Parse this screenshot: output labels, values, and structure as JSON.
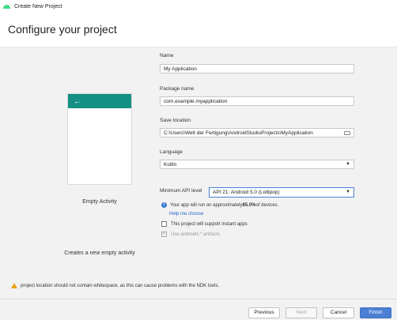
{
  "window": {
    "title": "Create New Project"
  },
  "header": {
    "title": "Configure your project"
  },
  "template": {
    "name": "Empty Activity",
    "description": "Creates a new empty activity",
    "back_arrow": "←"
  },
  "form": {
    "name": {
      "label": "Name",
      "value": "My Application"
    },
    "package": {
      "label": "Package name",
      "value": "com.example.myapplication"
    },
    "save_location": {
      "label": "Save location",
      "value": "C:\\Users\\Welt der Fertigung\\AndroidStudioProjects\\MyApplication"
    },
    "language": {
      "label": "Language",
      "value": "Kotlin"
    },
    "min_api": {
      "label": "Minimum API level",
      "value": "API 21: Android 5.0 (Lollipop)"
    },
    "info_text_before": "Your app will run on approximately ",
    "info_percent": "85.0%",
    "info_text_after": " of devices.",
    "help_link": "Help me choose",
    "instant_apps": {
      "label": "This project will support instant apps",
      "checked": false
    },
    "androidx": {
      "label": "Use androidx.* artifacts",
      "checked": true,
      "disabled": true
    }
  },
  "warning": "project location should not contain whitespace, as this can cause problems with the NDK tools.",
  "footer": {
    "previous": "Previous",
    "next": "Next",
    "cancel": "Cancel",
    "finish": "Finish"
  },
  "colors": {
    "accent": "#4a7fd4",
    "template_bar": "#148f84",
    "warning": "#e8a317"
  },
  "icons": {
    "app": "android-studio-icon",
    "back": "arrow-left-icon",
    "folder": "folder-icon",
    "dropdown": "chevron-down-icon",
    "info": "info-icon",
    "warning": "warning-icon"
  }
}
